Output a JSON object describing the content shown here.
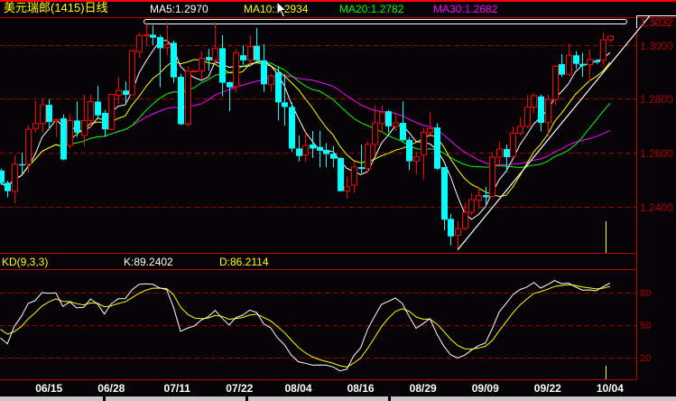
{
  "header": {
    "title": "美元瑞郎(1415)日线",
    "ma5": "MA5:1.2970",
    "ma10": "MA10:1.2934",
    "ma20": "MA20:1.2782",
    "ma30": "MA30:1.2682",
    "last_price": "1.3032"
  },
  "kd_header": {
    "name": "KD(9,3,3)",
    "k": "K:89.2402",
    "d": "D:86.2114"
  },
  "colors": {
    "up": "#ff0000",
    "down": "#00ffff",
    "ma5": "#ffffff",
    "ma10": "#ffff00",
    "ma20": "#00ff00",
    "ma30": "#ff00ff",
    "grid": "#a00000",
    "axis_text": "#b00000"
  },
  "chart_data": [
    {
      "type": "candlestick",
      "title": "美元瑞郎(1415)日线",
      "ylim": [
        1.2195,
        1.3135
      ],
      "y_ticks": [
        "1.3000",
        "1.2800",
        "1.2600",
        "1.2400"
      ],
      "y_tick_values": [
        1.3,
        1.28,
        1.26,
        1.24
      ],
      "moving_averages": [
        {
          "name": "MA5",
          "period": 5
        },
        {
          "name": "MA10",
          "period": 10
        },
        {
          "name": "MA20",
          "period": 20
        },
        {
          "name": "MA30",
          "period": 30
        }
      ],
      "trendline": [
        [
          66,
          1.2239
        ],
        [
          93.7,
          1.3106
        ]
      ],
      "ohlc": [
        [
          1.2533,
          1.254,
          1.2479,
          1.2488
        ],
        [
          1.2488,
          1.2496,
          1.2434,
          1.2457
        ],
        [
          1.2457,
          1.2591,
          1.2412,
          1.2557
        ],
        [
          1.2557,
          1.26,
          1.2524,
          1.2554
        ],
        [
          1.2557,
          1.2702,
          1.2524,
          1.2686
        ],
        [
          1.2689,
          1.2792,
          1.2674,
          1.2708
        ],
        [
          1.2708,
          1.2797,
          1.2674,
          1.2777
        ],
        [
          1.2777,
          1.2797,
          1.2686,
          1.2713
        ],
        [
          1.2717,
          1.2725,
          1.2658,
          1.2722
        ],
        [
          1.2727,
          1.2741,
          1.2571,
          1.2574
        ],
        [
          1.2626,
          1.2744,
          1.2615,
          1.2719
        ],
        [
          1.2719,
          1.2789,
          1.2658,
          1.2674
        ],
        [
          1.2663,
          1.2814,
          1.2624,
          1.2719
        ],
        [
          1.2719,
          1.2814,
          1.2691,
          1.2789
        ],
        [
          1.2789,
          1.2847,
          1.273,
          1.2738
        ],
        [
          1.2747,
          1.2758,
          1.2658,
          1.2686
        ],
        [
          1.2686,
          1.2818,
          1.2683,
          1.2816
        ],
        [
          1.2812,
          1.2881,
          1.278,
          1.283
        ],
        [
          1.283,
          1.2864,
          1.2783,
          1.2814
        ],
        [
          1.2814,
          1.2982,
          1.2814,
          1.2978
        ],
        [
          1.2974,
          1.3045,
          1.295,
          1.3034
        ],
        [
          1.3034,
          1.3082,
          1.2998,
          1.3037
        ],
        [
          1.3037,
          1.3071,
          1.2998,
          1.3026
        ],
        [
          1.3028,
          1.3037,
          1.2842,
          1.2987
        ],
        [
          1.2989,
          1.3082,
          1.2959,
          1.3
        ],
        [
          1.3007,
          1.3015,
          1.2859,
          1.2879
        ],
        [
          1.2881,
          1.2892,
          1.2702,
          1.2705
        ],
        [
          1.2705,
          1.292,
          1.2697,
          1.2901
        ],
        [
          1.29,
          1.2905,
          1.2898,
          1.2903
        ],
        [
          1.2903,
          1.2976,
          1.287,
          1.295
        ],
        [
          1.2954,
          1.2984,
          1.2903,
          1.2942
        ],
        [
          1.2942,
          1.3082,
          1.2931,
          1.2987
        ],
        [
          1.2987,
          1.3035,
          1.2808,
          1.2859
        ],
        [
          1.2861,
          1.2864,
          1.2753,
          1.2842
        ],
        [
          1.2844,
          1.2984,
          1.2825,
          1.297
        ],
        [
          1.2961,
          1.2998,
          1.2926,
          1.2942
        ],
        [
          1.2942,
          1.3035,
          1.2928,
          1.2993
        ],
        [
          1.2996,
          1.3062,
          1.2942,
          1.2942
        ],
        [
          1.2942,
          1.3002,
          1.2825,
          1.2853
        ],
        [
          1.2852,
          1.2892,
          1.2825,
          1.2885
        ],
        [
          1.2898,
          1.292,
          1.2719,
          1.2786
        ],
        [
          1.2786,
          1.2892,
          1.2699,
          1.2769
        ],
        [
          1.2769,
          1.2786,
          1.2602,
          1.2615
        ],
        [
          1.2615,
          1.2663,
          1.2566,
          1.2587
        ],
        [
          1.2591,
          1.2674,
          1.2566,
          1.2626
        ],
        [
          1.263,
          1.268,
          1.258,
          1.2615
        ],
        [
          1.2621,
          1.268,
          1.2546,
          1.2607
        ],
        [
          1.261,
          1.2635,
          1.2546,
          1.2594
        ],
        [
          1.2596,
          1.2624,
          1.2546,
          1.2577
        ],
        [
          1.258,
          1.2582,
          1.2455,
          1.2457
        ],
        [
          1.2457,
          1.2512,
          1.2429,
          1.2473
        ],
        [
          1.2479,
          1.2568,
          1.2451,
          1.2546
        ],
        [
          1.2546,
          1.263,
          1.2524,
          1.2539
        ],
        [
          1.254,
          1.2641,
          1.2529,
          1.263
        ],
        [
          1.263,
          1.2775,
          1.2591,
          1.271
        ],
        [
          1.2708,
          1.2775,
          1.2674,
          1.2747
        ],
        [
          1.2753,
          1.2758,
          1.2674,
          1.2697
        ],
        [
          1.2697,
          1.2741,
          1.268,
          1.271
        ],
        [
          1.271,
          1.2789,
          1.2641,
          1.2646
        ],
        [
          1.2647,
          1.2658,
          1.2535,
          1.2568
        ],
        [
          1.2568,
          1.2602,
          1.2518,
          1.2585
        ],
        [
          1.2591,
          1.2691,
          1.2501,
          1.2674
        ],
        [
          1.2674,
          1.275,
          1.2658,
          1.2689
        ],
        [
          1.2693,
          1.2708,
          1.2535,
          1.254
        ],
        [
          1.2546,
          1.2546,
          1.2311,
          1.2351
        ],
        [
          1.2354,
          1.2373,
          1.2256,
          1.2289
        ],
        [
          1.2293,
          1.2345,
          1.2239,
          1.2317
        ],
        [
          1.2319,
          1.2412,
          1.2311,
          1.2378
        ],
        [
          1.2378,
          1.2448,
          1.2367,
          1.2425
        ],
        [
          1.2423,
          1.247,
          1.239,
          1.244
        ],
        [
          1.2442,
          1.2473,
          1.2401,
          1.2434
        ],
        [
          1.2437,
          1.2602,
          1.2434,
          1.2583
        ],
        [
          1.2583,
          1.2641,
          1.2546,
          1.2613
        ],
        [
          1.2613,
          1.263,
          1.2529,
          1.2583
        ],
        [
          1.2585,
          1.2697,
          1.258,
          1.2672
        ],
        [
          1.2672,
          1.273,
          1.2663,
          1.2697
        ],
        [
          1.2697,
          1.2814,
          1.2691,
          1.2769
        ],
        [
          1.2769,
          1.282,
          1.2747,
          1.2811
        ],
        [
          1.2808,
          1.2814,
          1.2678,
          1.271
        ],
        [
          1.2711,
          1.2814,
          1.2658,
          1.2797
        ],
        [
          1.2797,
          1.2926,
          1.2775,
          1.292
        ],
        [
          1.2928,
          1.2965,
          1.2881,
          1.2889
        ],
        [
          1.2889,
          1.3004,
          1.2883,
          1.2961
        ],
        [
          1.2961,
          1.2976,
          1.2911,
          1.2929
        ],
        [
          1.2929,
          1.297,
          1.2881,
          1.2922
        ],
        [
          1.2926,
          1.2982,
          1.2864,
          1.2945
        ],
        [
          1.2942,
          1.2947,
          1.2929,
          1.2935
        ],
        [
          1.2942,
          1.3045,
          1.292,
          1.3018
        ],
        [
          1.3018,
          1.3032,
          1.3009,
          1.3032
        ]
      ]
    },
    {
      "type": "line",
      "title": "KD(9,3,3)",
      "ylim": [
        0,
        100
      ],
      "y_ticks": [
        "80",
        "50",
        "20"
      ],
      "y_tick_values": [
        80,
        50,
        20
      ],
      "series": [
        {
          "name": "K",
          "last": 89.2402
        },
        {
          "name": "D",
          "last": 86.2114
        }
      ]
    }
  ],
  "x_axis": {
    "labels": [
      "06/15",
      "06/28",
      "07/11",
      "07/22",
      "08/04",
      "08/16",
      "08/29",
      "09/09",
      "09/22",
      "10/04"
    ],
    "label_index": [
      7,
      16,
      25.5,
      34.5,
      43,
      52,
      61,
      70,
      79,
      88
    ]
  }
}
